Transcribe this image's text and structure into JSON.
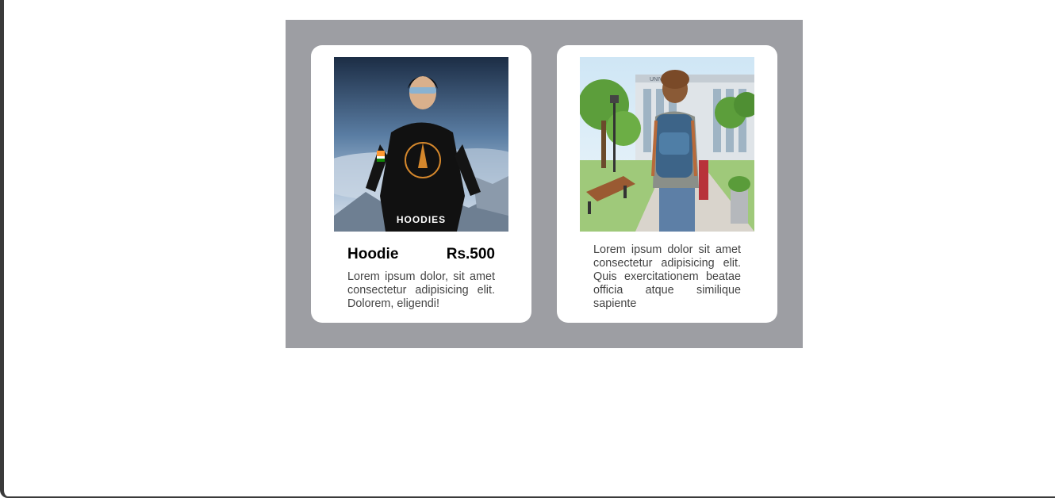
{
  "cards": [
    {
      "image_label": "HOODIES",
      "title": "Hoodie",
      "price": "Rs.500",
      "description": "Lorem ipsum dolor, sit amet consectetur adipisicing elit. Dolorem, eligendi!"
    },
    {
      "image_label": "UNIVERSITY",
      "description": "Lorem ipsum dolor sit amet consectetur adipisicing elit. Quis exercitationem beatae officia atque similique sapiente"
    }
  ]
}
